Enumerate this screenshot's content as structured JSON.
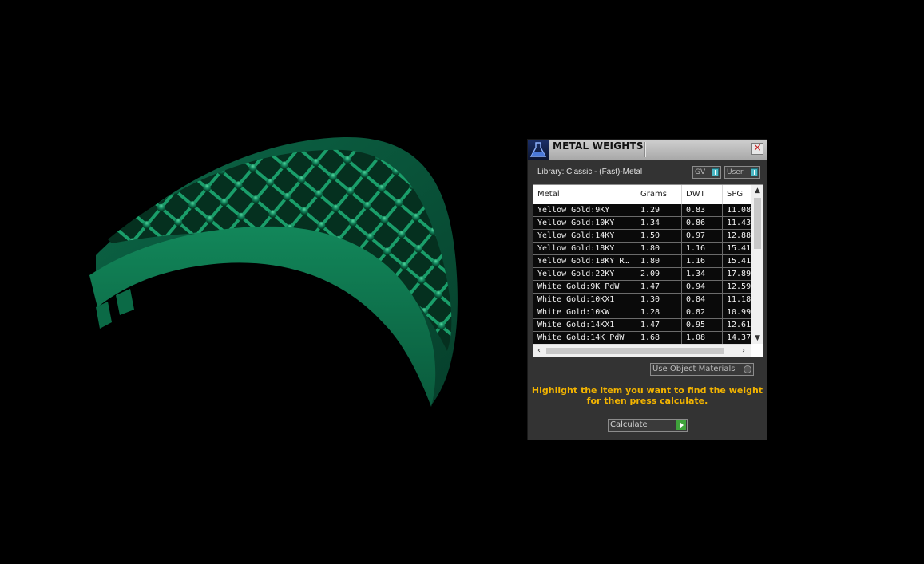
{
  "panel": {
    "title": "METAL WEIGHTS",
    "close_label": "×",
    "library_label": "Library: Classic - (Fast)-Metal",
    "toggle_gv": "GV",
    "toggle_user": "User",
    "use_object_materials": "Use Object Materials",
    "hint_line1": "Highlight the item you want to find the weight",
    "hint_line2": "for then press calculate.",
    "calculate_label": "Calculate"
  },
  "table": {
    "columns": [
      "Metal",
      "Grams",
      "DWT",
      "SPG"
    ],
    "rows": [
      [
        "Yellow Gold:9KY",
        "1.29",
        "0.83",
        "11.08"
      ],
      [
        "Yellow Gold:10KY",
        "1.34",
        "0.86",
        "11.43"
      ],
      [
        "Yellow Gold:14KY",
        "1.50",
        "0.97",
        "12.88"
      ],
      [
        "Yellow Gold:18KY",
        "1.80",
        "1.16",
        "15.41"
      ],
      [
        "Yellow Gold:18KY R…",
        "1.80",
        "1.16",
        "15.41"
      ],
      [
        "Yellow Gold:22KY",
        "2.09",
        "1.34",
        "17.89"
      ],
      [
        "White Gold:9K PdW",
        "1.47",
        "0.94",
        "12.59"
      ],
      [
        "White Gold:10KX1",
        "1.30",
        "0.84",
        "11.18"
      ],
      [
        "White Gold:10KW",
        "1.28",
        "0.82",
        "10.99"
      ],
      [
        "White Gold:14KX1",
        "1.47",
        "0.95",
        "12.61"
      ],
      [
        "White Gold:14K PdW",
        "1.68",
        "1.08",
        "14.37"
      ]
    ]
  },
  "colors": {
    "viewport_bg": "#000000",
    "model": "#0e6e4b",
    "panel_bg": "#333333",
    "hint": "#f3b400",
    "toggle_accent": "#4cb8c4",
    "calc_accent": "#3fa33b"
  },
  "icons": {
    "app_logo": "flask-logo-icon",
    "close": "close-icon",
    "calculate": "play-arrow-icon"
  }
}
